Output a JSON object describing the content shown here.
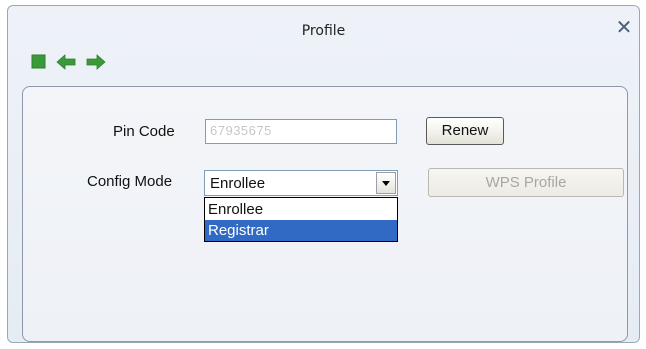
{
  "window": {
    "title": "Profile"
  },
  "toolbar": {
    "icons": [
      "stop-icon",
      "back-arrow-icon",
      "forward-arrow-icon"
    ],
    "icon_color": "#3a9a3a"
  },
  "form": {
    "pin_label": "Pin Code",
    "pin_value": "67935675",
    "renew_label": "Renew",
    "config_label": "Config Mode",
    "config_selected": "Enrollee",
    "wps_profile_label": "WPS Profile",
    "options": [
      "Enrollee",
      "Registrar"
    ],
    "highlighted_option": "Registrar"
  },
  "colors": {
    "highlight": "#316ac5",
    "disabled_text": "#a8a8a0"
  }
}
